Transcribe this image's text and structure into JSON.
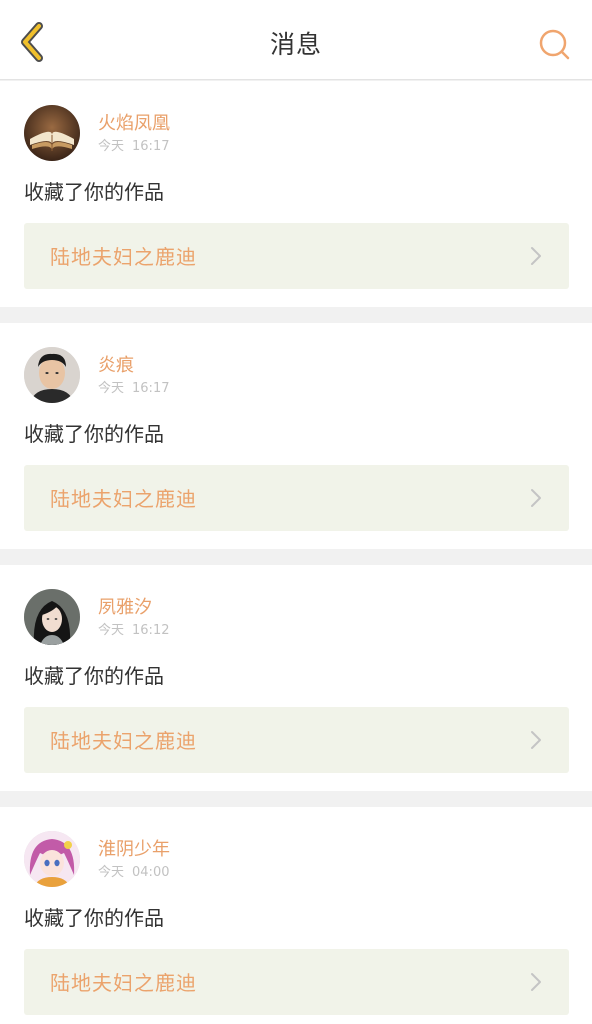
{
  "header": {
    "title": "消息",
    "back_icon": "chevron-left-icon",
    "search_icon": "search-icon",
    "accent_color": "#f0c02c",
    "search_color": "#f0a56e"
  },
  "messages": [
    {
      "user": "火焰凤凰",
      "day": "今天",
      "time": "16:17",
      "action": "收藏了你的作品",
      "work": "陆地夫妇之鹿迪",
      "avatar": "book-avatar"
    },
    {
      "user": "炎痕",
      "day": "今天",
      "time": "16:17",
      "action": "收藏了你的作品",
      "work": "陆地夫妇之鹿迪",
      "avatar": "man-avatar"
    },
    {
      "user": "夙雅汐",
      "day": "今天",
      "time": "16:12",
      "action": "收藏了你的作品",
      "work": "陆地夫妇之鹿迪",
      "avatar": "woman-avatar"
    },
    {
      "user": "淮阴少年",
      "day": "今天",
      "time": "04:00",
      "action": "收藏了你的作品",
      "work": "陆地夫妇之鹿迪",
      "avatar": "anime-avatar"
    }
  ]
}
